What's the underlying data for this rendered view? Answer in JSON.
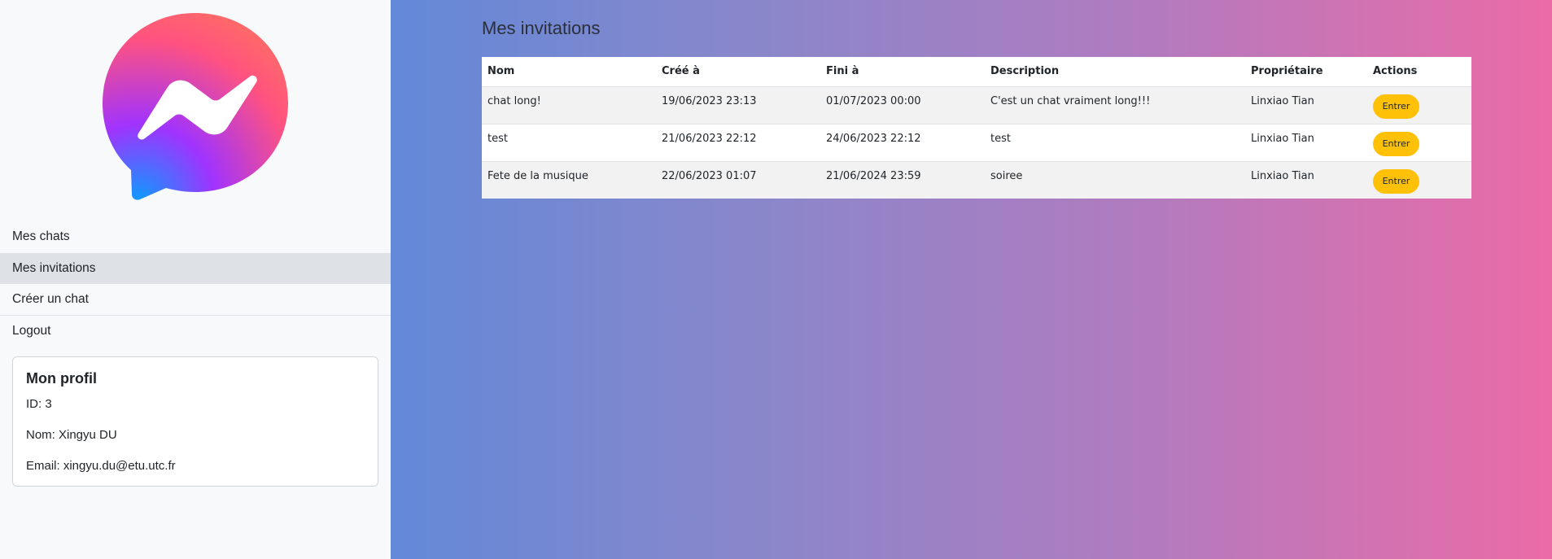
{
  "sidebar": {
    "logo_name": "messenger-logo",
    "nav": [
      {
        "label": "Mes chats"
      },
      {
        "label": "Mes invitations"
      },
      {
        "label": "Créer un chat"
      },
      {
        "label": "Logout"
      }
    ],
    "profile": {
      "title": "Mon profil",
      "id": "ID: 3",
      "nom": "Nom: Xingyu DU",
      "email": "Email: xingyu.du@etu.utc.fr"
    }
  },
  "main": {
    "title": "Mes invitations",
    "table": {
      "headers": [
        "Nom",
        "Créé à",
        "Fini à",
        "Description",
        "Propriétaire",
        "Actions"
      ],
      "rows": [
        {
          "nom": "chat long!",
          "cree": "19/06/2023 23:13",
          "fini": "01/07/2023 00:00",
          "description": "C'est un chat vraiment long!!!",
          "proprietaire": "Linxiao Tian",
          "action": "Entrer"
        },
        {
          "nom": "test",
          "cree": "21/06/2023 22:12",
          "fini": "24/06/2023 22:12",
          "description": "test",
          "proprietaire": "Linxiao Tian",
          "action": "Entrer"
        },
        {
          "nom": "Fete de la musique",
          "cree": "22/06/2023 01:07",
          "fini": "21/06/2024 23:59",
          "description": "soiree",
          "proprietaire": "Linxiao Tian",
          "action": "Entrer"
        }
      ]
    }
  },
  "colors": {
    "sidebar_bg": "#f8f9fa",
    "active_nav_bg": "#dee2e6",
    "button_accent": "#ffc107",
    "gradient_start": "#6389d8",
    "gradient_end": "#eb6ba7"
  }
}
